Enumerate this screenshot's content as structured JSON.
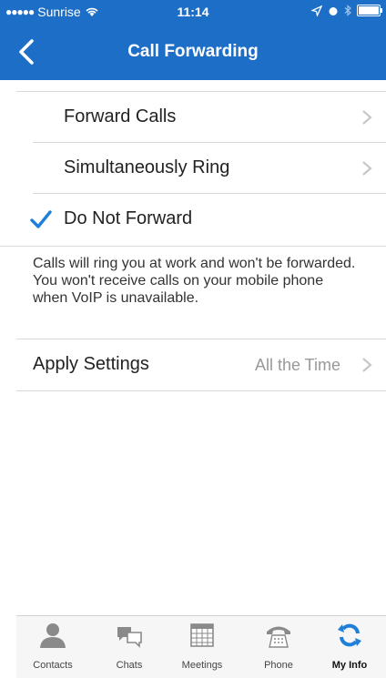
{
  "status_bar": {
    "carrier": "Sunrise",
    "signal_dots": "●●●●●",
    "time": "11:14"
  },
  "nav": {
    "title": "Call Forwarding",
    "back_icon": "chevron-left-icon"
  },
  "options": [
    {
      "label": "Forward Calls",
      "checked": false
    },
    {
      "label": "Simultaneously Ring",
      "checked": false
    },
    {
      "label": "Do Not Forward",
      "checked": true
    }
  ],
  "description": "Calls will ring you at work and won't be forwarded. You won't receive calls on your mobile phone when VoIP is unavailable.",
  "apply_settings": {
    "label": "Apply Settings",
    "value": "All the Time"
  },
  "colors": {
    "brand_blue": "#1c6ec7",
    "check_blue": "#1f7fd9"
  },
  "tabs": [
    {
      "label": "Contacts",
      "icon": "person-icon",
      "active": false
    },
    {
      "label": "Chats",
      "icon": "chat-bubbles-icon",
      "active": false
    },
    {
      "label": "Meetings",
      "icon": "calendar-icon",
      "active": false
    },
    {
      "label": "Phone",
      "icon": "phone-icon",
      "active": false
    },
    {
      "label": "My Info",
      "icon": "sync-arrows-icon",
      "active": true
    }
  ]
}
